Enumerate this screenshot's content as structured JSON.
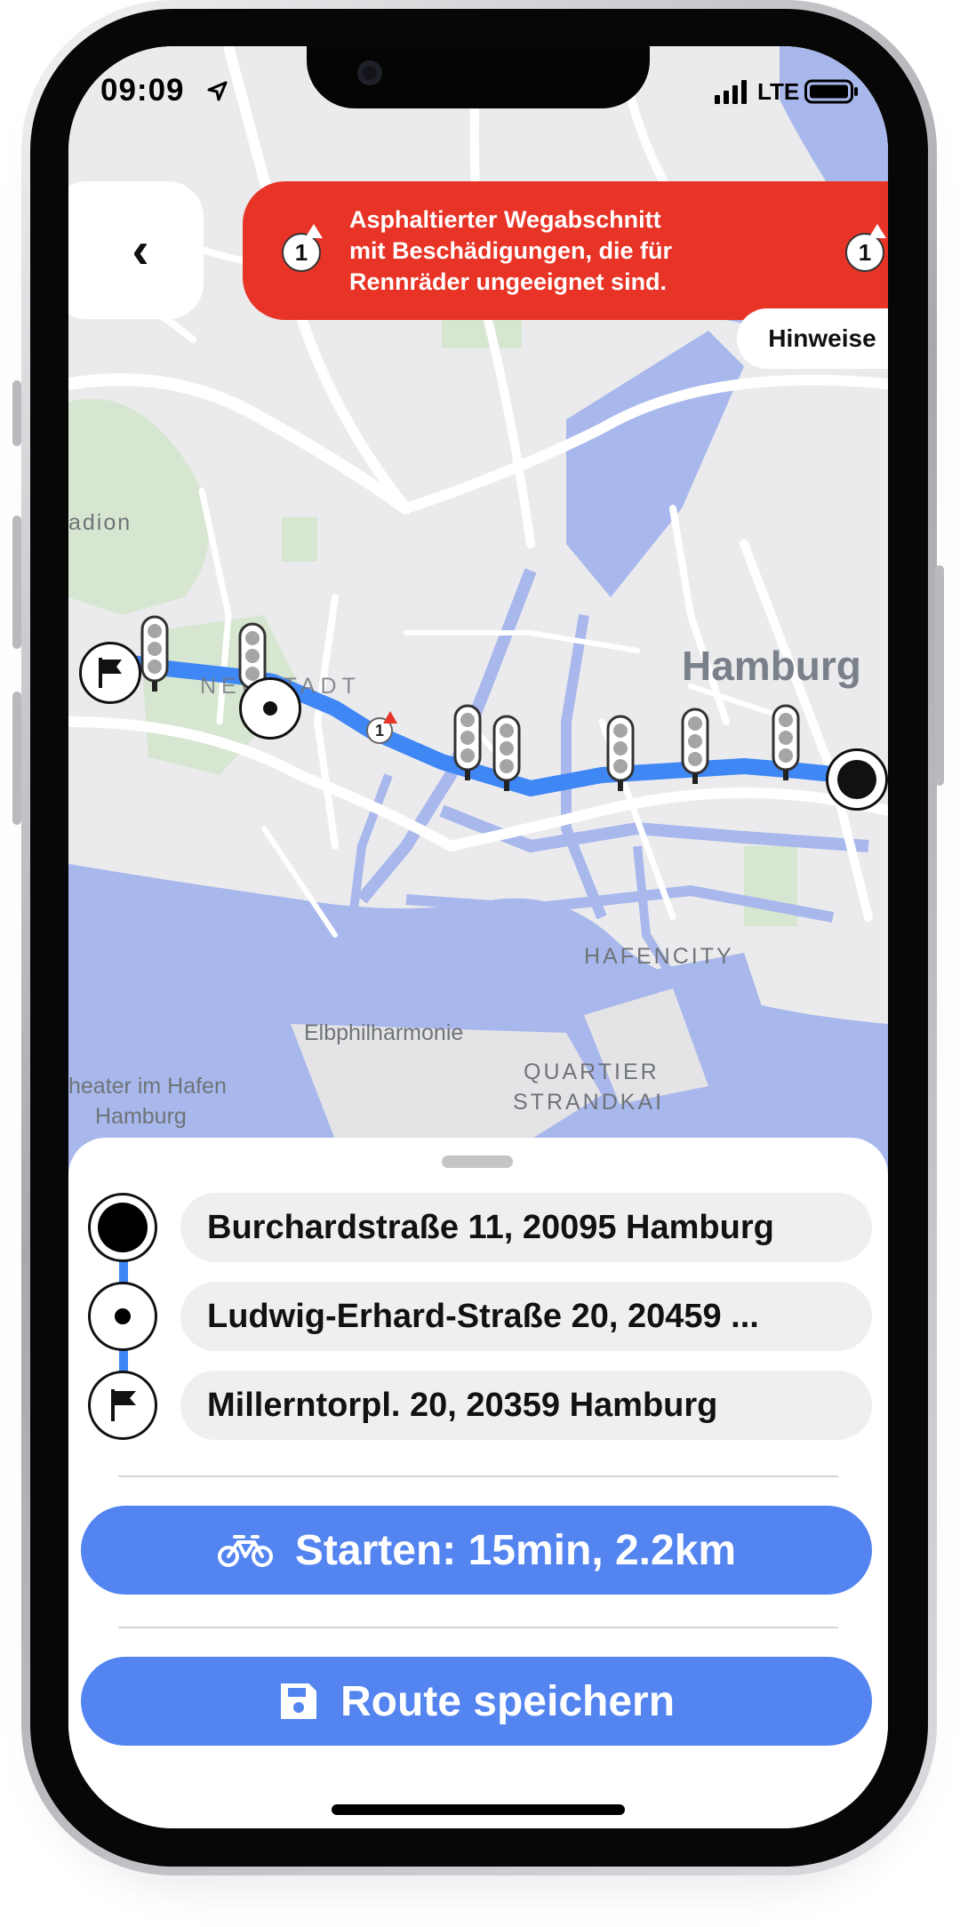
{
  "status_bar": {
    "time": "09:09",
    "network": "LTE"
  },
  "alert": {
    "badge_count": "1",
    "message_line1": "Asphaltierter Wegabschnitt",
    "message_line2": "mit Beschädigungen, die für",
    "message_line3": "Rennräder ungeeignet sind.",
    "hints_button": "Hinweise"
  },
  "map": {
    "labels": {
      "stadion": "adion",
      "neustadt": "NEUSTADT",
      "city": "Hamburg",
      "hafencity": "HAFENCITY",
      "elbphilharmonie": "Elbphilharmonie",
      "theater_line1": "heater im Hafen",
      "theater_line2": "Hamburg",
      "quartier_line1": "QUARTIER",
      "quartier_line2": "STRANDKAI"
    },
    "warning_marker": "1"
  },
  "route": {
    "stops": [
      {
        "icon": "record-icon",
        "label": "Burchardstraße 11, 20095 Hamburg"
      },
      {
        "icon": "dot-icon",
        "label": "Ludwig-Erhard-Straße 20, 20459 ..."
      },
      {
        "icon": "flag-icon",
        "label": "Millerntorpl. 20, 20359 Hamburg"
      }
    ],
    "start_button": "Starten: 15min, 2.2km",
    "save_button": "Route speichern"
  },
  "colors": {
    "route": "#3f87f5",
    "alert": "#e83426",
    "button": "#5384f0",
    "water": "#a9b8ec",
    "map_bg": "#ebebed"
  }
}
